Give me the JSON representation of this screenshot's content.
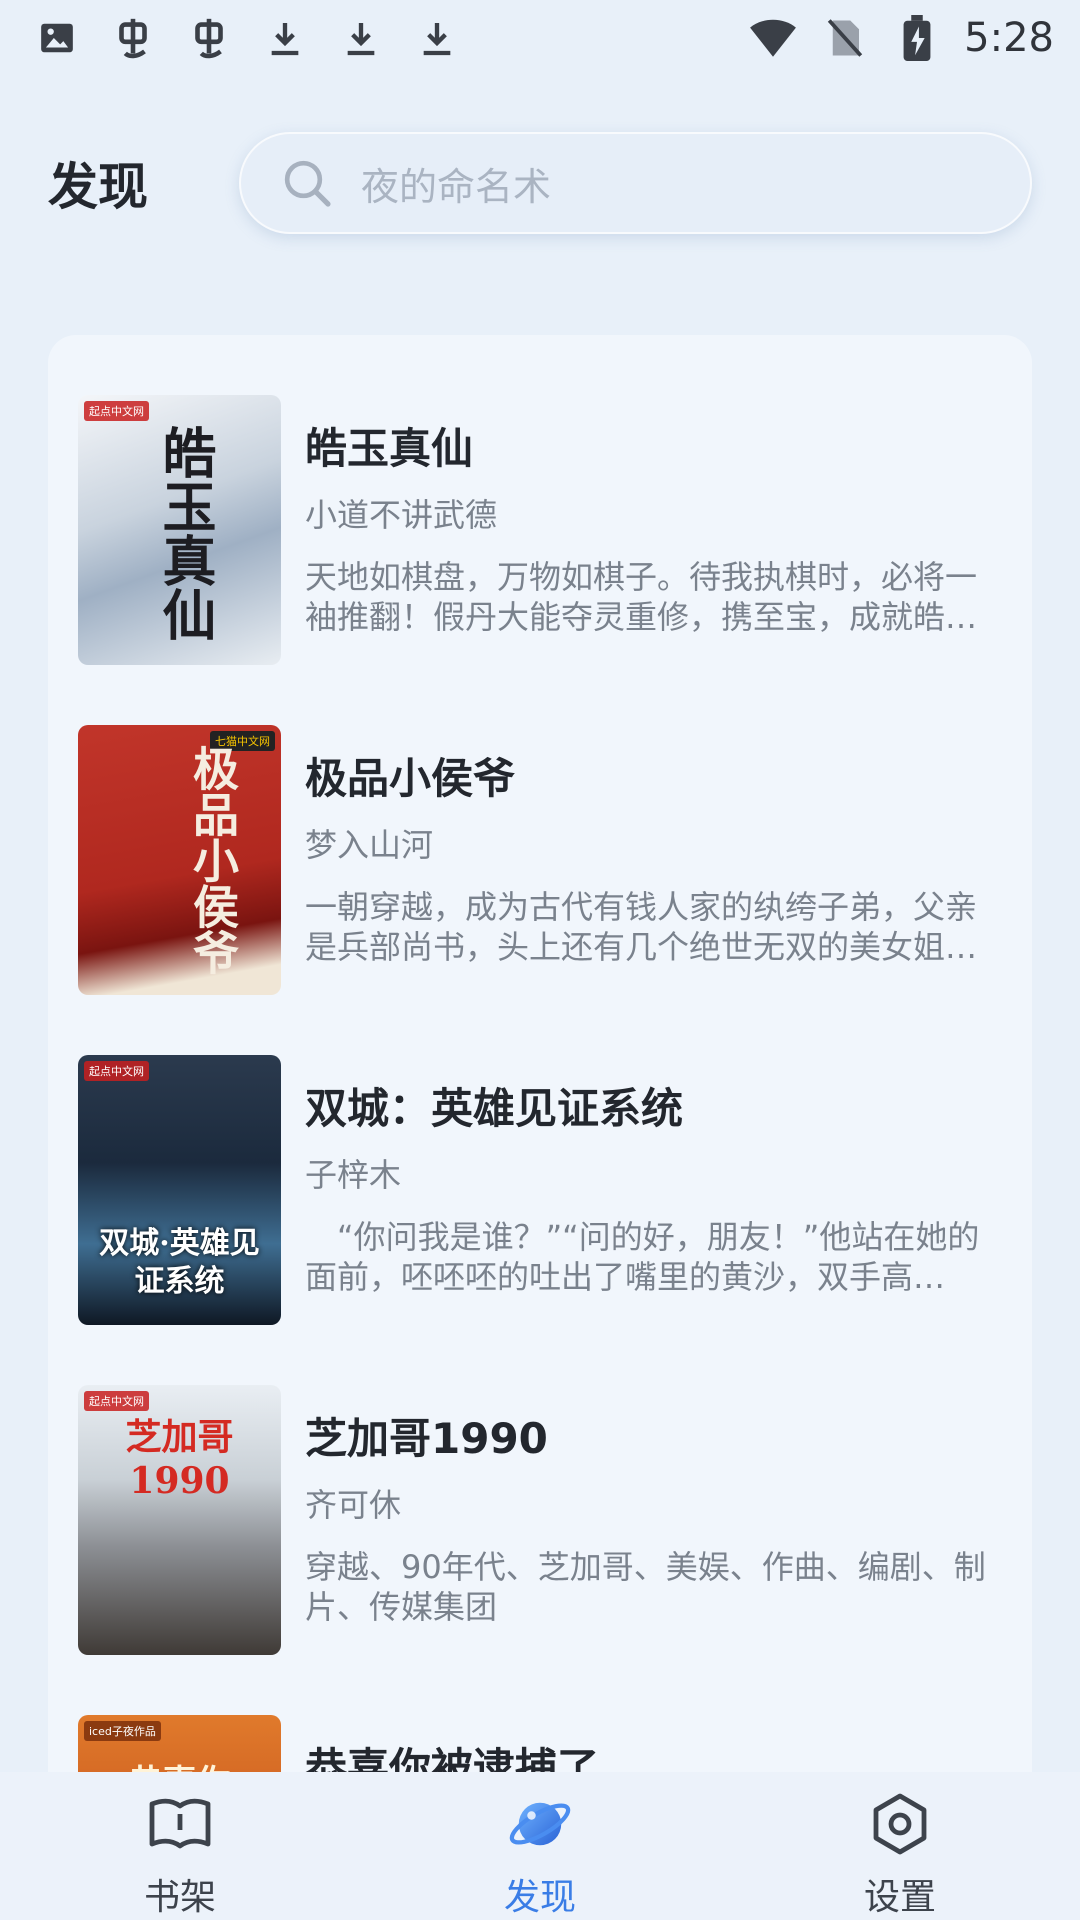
{
  "status_bar": {
    "time": "5:28",
    "left_icons": [
      "image-icon",
      "bug-icon",
      "bug-icon",
      "download-icon",
      "download-icon",
      "download-icon"
    ],
    "right_icons": [
      "wifi-icon",
      "no-sim-icon",
      "battery-charging-icon"
    ]
  },
  "header": {
    "title": "发现",
    "search_placeholder": "夜的命名术"
  },
  "books": [
    {
      "title": "皓玉真仙",
      "author": "小道不讲武德",
      "desc": "天地如棋盘，万物如棋子。待我执棋时，必将一袖推翻！假丹大能夺灵重修，携至宝，成就皓玉真仙……",
      "cover_text": "皓玉真仙",
      "cover_badge": "起点中文网"
    },
    {
      "title": "极品小侯爷",
      "author": "梦入山河",
      "desc": "一朝穿越，成为古代有钱人家的纨绔子弟，父亲是兵部尚书，头上还有几个绝世无双的美女姐姐……",
      "cover_text": "极品小侯爷",
      "cover_badge": "七猫中文网"
    },
    {
      "title": "双城：英雄见证系统",
      "author": "子梓木",
      "desc": "　“你问我是谁？”“问的好，朋友！”他站在她的面前，呸呸呸的吐出了嘴里的黄沙，双手高举……",
      "cover_text": "双城·英雄见证系统",
      "cover_badge": "起点中文网"
    },
    {
      "title": "芝加哥1990",
      "author": "齐可休",
      "desc": "穿越、90年代、芝加哥、美娱、作曲、编剧、制片、传媒集团",
      "cover_text": "芝加哥1990",
      "cover_badge": "起点中文网"
    },
    {
      "title": "恭喜你被逮捕了",
      "author": "",
      "desc": "",
      "cover_text": "恭喜你",
      "cover_badge": "iced子夜作品"
    }
  ],
  "nav": {
    "bookshelf": "书架",
    "discover": "发现",
    "settings": "设置"
  },
  "colors": {
    "accent": "#3a7de6",
    "background": "#e8f0f9",
    "card": "#f1f6fc"
  }
}
